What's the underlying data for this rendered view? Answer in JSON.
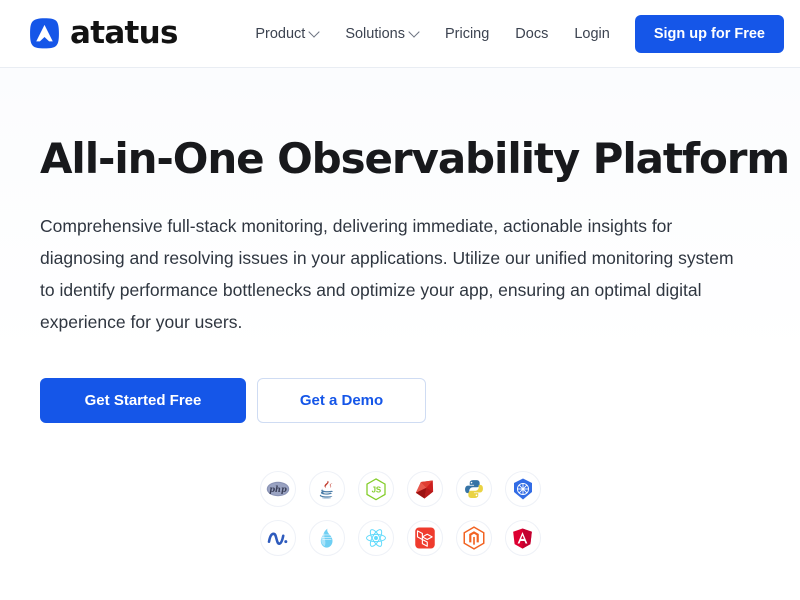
{
  "header": {
    "brand_name": "atatus",
    "logo_icon": "atatus-logo-icon",
    "nav": [
      {
        "label": "Product",
        "has_dropdown": true,
        "icon": "chevron-down-icon"
      },
      {
        "label": "Solutions",
        "has_dropdown": true,
        "icon": "chevron-down-icon"
      },
      {
        "label": "Pricing",
        "has_dropdown": false,
        "icon": ""
      },
      {
        "label": "Docs",
        "has_dropdown": false,
        "icon": ""
      },
      {
        "label": "Login",
        "has_dropdown": false,
        "icon": ""
      }
    ],
    "signup_label": "Sign up for Free"
  },
  "hero": {
    "headline": "All-in-One Observability Platform",
    "subtext": "Comprehensive full-stack monitoring, delivering immediate, actionable insights for diagnosing and resolving issues in your applications. Utilize our unified monitoring system to identify performance bottlenecks and optimize your app, ensuring an optimal digital experience for your users.",
    "primary_cta": "Get Started Free",
    "secondary_cta": "Get a Demo"
  },
  "tech_icons": {
    "row1": [
      {
        "name": "php-icon",
        "label": "PHP"
      },
      {
        "name": "java-icon",
        "label": "Java"
      },
      {
        "name": "nodejs-icon",
        "label": "Node.js"
      },
      {
        "name": "ruby-icon",
        "label": "Ruby"
      },
      {
        "name": "python-icon",
        "label": "Python"
      },
      {
        "name": "kubernetes-icon",
        "label": "Kubernetes"
      }
    ],
    "row2": [
      {
        "name": "dotnet-icon",
        "label": ".NET"
      },
      {
        "name": "elixir-icon",
        "label": "Elixir"
      },
      {
        "name": "react-icon",
        "label": "React"
      },
      {
        "name": "laravel-icon",
        "label": "Laravel"
      },
      {
        "name": "magento-icon",
        "label": "Magento"
      },
      {
        "name": "angular-icon",
        "label": "Angular"
      }
    ]
  },
  "colors": {
    "brand_blue": "#1556e8",
    "text_dark": "#18191c",
    "text_body": "#2f3640",
    "nav_text": "#3c4350",
    "border_light": "#e9edf3",
    "page_bg": "#ffffff"
  }
}
